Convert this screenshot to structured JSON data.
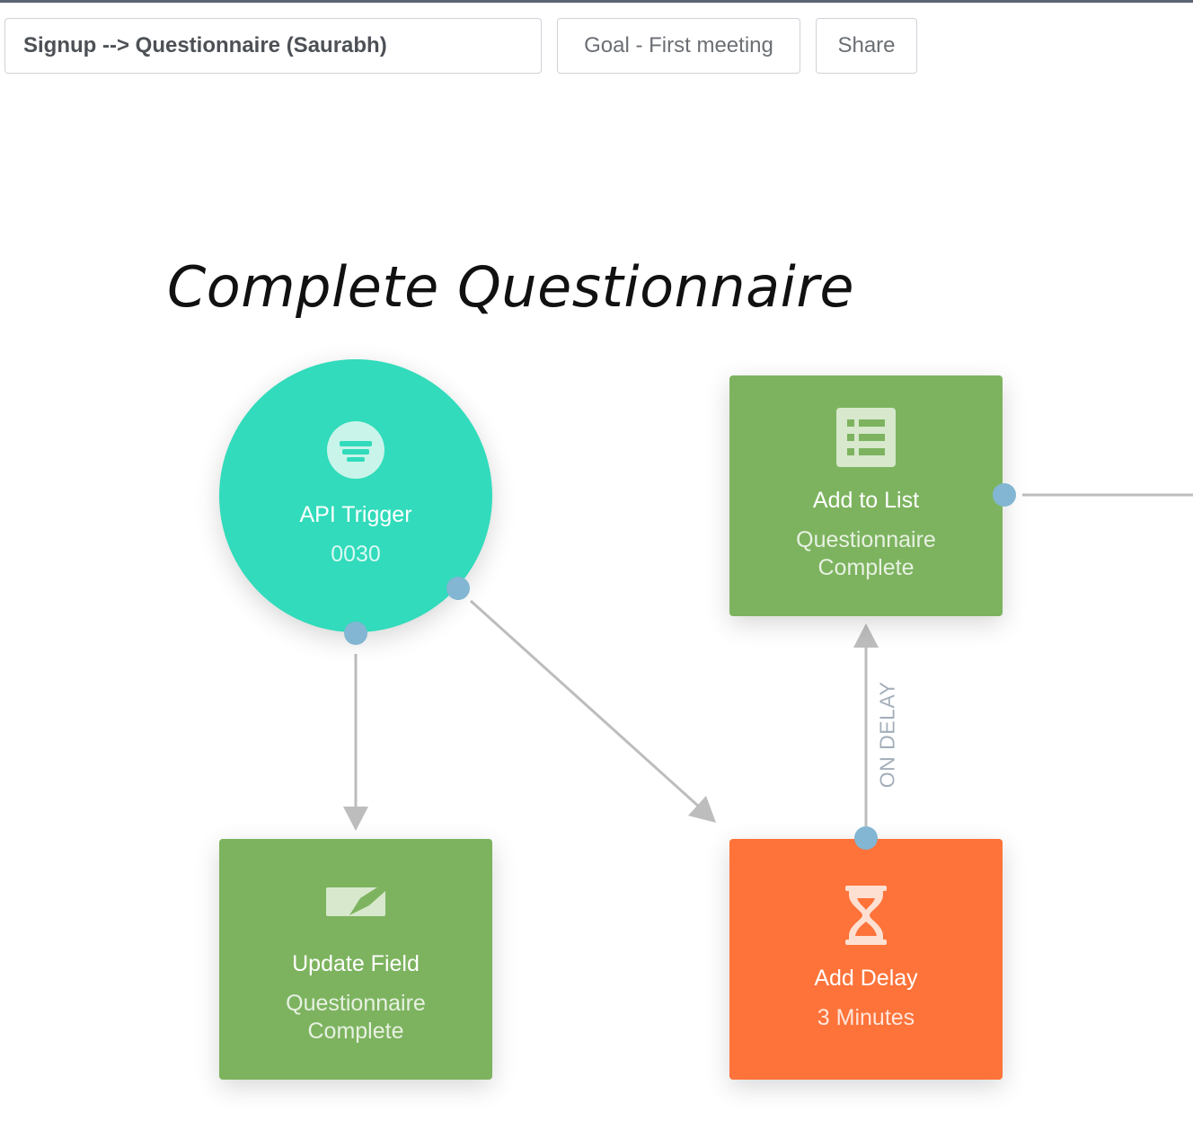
{
  "toolbar": {
    "title_value": "Signup --> Questionnaire (Saurabh)",
    "goal_label": "Goal - First meeting",
    "share_label": "Share"
  },
  "canvas": {
    "heading": "Complete Questionnaire"
  },
  "nodes": {
    "api_trigger": {
      "name": "API Trigger",
      "detail": "0030",
      "icon": "funnel-icon",
      "color": "#31dbbb"
    },
    "add_to_list": {
      "name": "Add to List",
      "detail": "Questionnaire Complete",
      "icon": "list-icon",
      "color": "#7db35f"
    },
    "update_field": {
      "name": "Update Field",
      "detail": "Questionnaire Complete",
      "icon": "envelope-edit-icon",
      "color": "#7db35f"
    },
    "add_delay": {
      "name": "Add Delay",
      "detail": "3 Minutes",
      "icon": "hourglass-icon",
      "color": "#fd733a"
    }
  },
  "edges": {
    "delay_to_list_label": "ON DELAY"
  },
  "colors": {
    "port": "#82b6d2",
    "connector": "#bdbdbd",
    "edge_label": "#a3aeba"
  }
}
